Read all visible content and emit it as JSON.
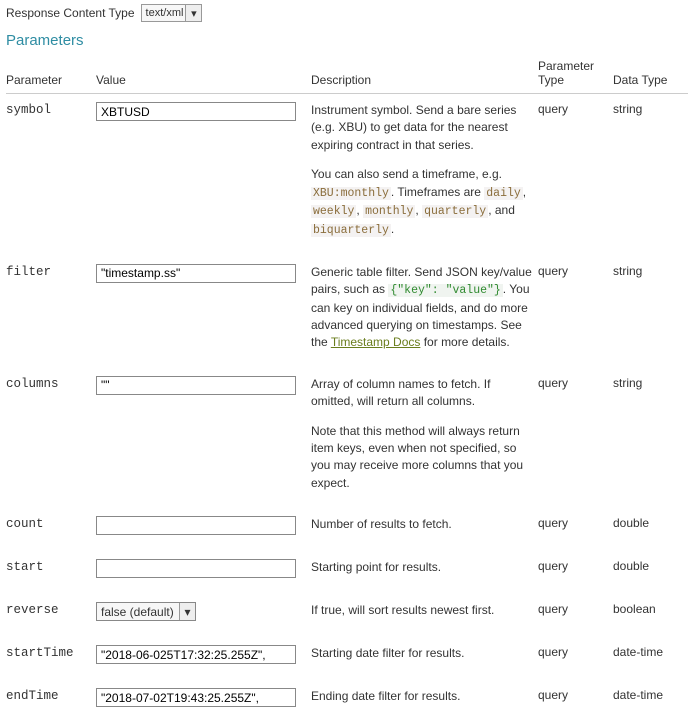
{
  "responseType": {
    "label": "Response Content Type",
    "value": "text/xml"
  },
  "section": {
    "title": "Parameters"
  },
  "headers": {
    "parameter": "Parameter",
    "value": "Value",
    "description": "Description",
    "ptype": "Parameter Type",
    "dtype": "Data Type"
  },
  "rows": [
    {
      "name": "symbol",
      "value": "XBTUSD",
      "desc": {
        "p1": "Instrument symbol. Send a bare series (e.g. XBU) to get data for the nearest expiring contract in that series.",
        "p2a": "You can also send a timeframe, e.g. ",
        "c1": "XBU:monthly",
        "p2b": ". Timeframes are ",
        "c2": "daily",
        "c3": "weekly",
        "c4": "monthly",
        "c5": "quarterly",
        "p2c": ", and ",
        "c6": "biquarterly"
      },
      "ptype": "query",
      "dtype": "string"
    },
    {
      "name": "filter",
      "value": "\"timestamp.ss\"",
      "desc": {
        "p1a": "Generic table filter. Send JSON key/value pairs, such as ",
        "c1": "{\"key\": \"value\"}",
        "p1b": ". You can key on individual fields, and do more advanced querying on timestamps. See the ",
        "link": "Timestamp Docs",
        "p1c": " for more details."
      },
      "ptype": "query",
      "dtype": "string"
    },
    {
      "name": "columns",
      "value": "\"\"",
      "desc": {
        "p1": "Array of column names to fetch. If omitted, will return all columns.",
        "p2": "Note that this method will always return item keys, even when not specified, so you may receive more columns that you expect."
      },
      "ptype": "query",
      "dtype": "string"
    },
    {
      "name": "count",
      "value": "",
      "desc": {
        "p1": "Number of results to fetch."
      },
      "ptype": "query",
      "dtype": "double"
    },
    {
      "name": "start",
      "value": "",
      "desc": {
        "p1": "Starting point for results."
      },
      "ptype": "query",
      "dtype": "double"
    },
    {
      "name": "reverse",
      "value": "false (default)",
      "desc": {
        "p1": "If true, will sort results newest first."
      },
      "ptype": "query",
      "dtype": "boolean"
    },
    {
      "name": "startTime",
      "value": "\"2018-06-025T17:32:25.255Z\",",
      "desc": {
        "p1": "Starting date filter for results."
      },
      "ptype": "query",
      "dtype": "date-time"
    },
    {
      "name": "endTime",
      "value": "\"2018-07-02T19:43:25.255Z\",",
      "desc": {
        "p1": "Ending date filter for results."
      },
      "ptype": "query",
      "dtype": "date-time"
    }
  ]
}
